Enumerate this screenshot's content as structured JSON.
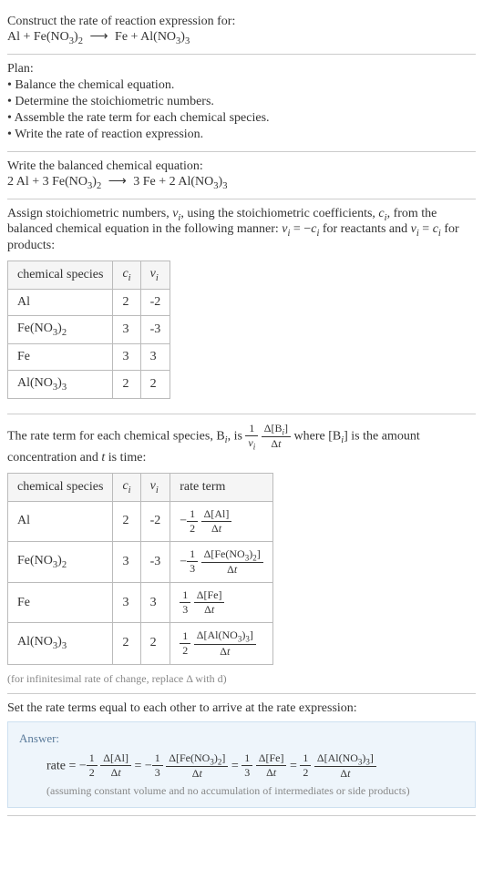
{
  "intro": {
    "prompt": "Construct the rate of reaction expression for:"
  },
  "plan": {
    "heading": "Plan:",
    "items": [
      "Balance the chemical equation.",
      "Determine the stoichiometric numbers.",
      "Assemble the rate term for each chemical species.",
      "Write the rate of reaction expression."
    ]
  },
  "balanced": {
    "heading": "Write the balanced chemical equation:"
  },
  "assign": {
    "text_before": "Assign stoichiometric numbers, ",
    "text_mid1": ", using the stoichiometric coefficients, ",
    "text_mid2": ", from the balanced chemical equation in the following manner: ",
    "text_mid3": " for reactants and ",
    "text_after": " for products:"
  },
  "table1": {
    "headers": [
      "chemical species",
      "cᵢ",
      "νᵢ"
    ],
    "rows": [
      {
        "species": "Al",
        "c": "2",
        "nu": "-2"
      },
      {
        "species": "Fe(NO₃)₂",
        "c": "3",
        "nu": "-3"
      },
      {
        "species": "Fe",
        "c": "3",
        "nu": "3"
      },
      {
        "species": "Al(NO₃)₃",
        "c": "2",
        "nu": "2"
      }
    ]
  },
  "rateterm": {
    "text1": "The rate term for each chemical species, B",
    "text2": ", is ",
    "text3": " where [B",
    "text4": "] is the amount concentration and ",
    "text5": " is time:"
  },
  "table2": {
    "headers": [
      "chemical species",
      "cᵢ",
      "νᵢ",
      "rate term"
    ],
    "rows": [
      {
        "species": "Al",
        "c": "2",
        "nu": "-2"
      },
      {
        "species": "Fe(NO₃)₂",
        "c": "3",
        "nu": "-3"
      },
      {
        "species": "Fe",
        "c": "3",
        "nu": "3"
      },
      {
        "species": "Al(NO₃)₃",
        "c": "2",
        "nu": "2"
      }
    ]
  },
  "note": "(for infinitesimal rate of change, replace Δ with d)",
  "setequal": "Set the rate terms equal to each other to arrive at the rate expression:",
  "answer": {
    "label": "Answer:",
    "prefix": "rate = ",
    "assumption": "(assuming constant volume and no accumulation of intermediates or side products)"
  },
  "chart_data": {
    "type": "table",
    "reaction_unbalanced": {
      "reactants": [
        {
          "coef": 1,
          "species": "Al"
        },
        {
          "coef": 1,
          "species": "Fe(NO3)2"
        }
      ],
      "products": [
        {
          "coef": 1,
          "species": "Fe"
        },
        {
          "coef": 1,
          "species": "Al(NO3)3"
        }
      ]
    },
    "reaction_balanced": {
      "reactants": [
        {
          "coef": 2,
          "species": "Al"
        },
        {
          "coef": 3,
          "species": "Fe(NO3)2"
        }
      ],
      "products": [
        {
          "coef": 3,
          "species": "Fe"
        },
        {
          "coef": 2,
          "species": "Al(NO3)3"
        }
      ]
    },
    "stoichiometric_table": [
      {
        "species": "Al",
        "c_i": 2,
        "nu_i": -2
      },
      {
        "species": "Fe(NO3)2",
        "c_i": 3,
        "nu_i": -3
      },
      {
        "species": "Fe",
        "c_i": 3,
        "nu_i": 3
      },
      {
        "species": "Al(NO3)3",
        "c_i": 2,
        "nu_i": 2
      }
    ],
    "rate_terms": [
      {
        "species": "Al",
        "c_i": 2,
        "nu_i": -2,
        "term": "-(1/2) Δ[Al]/Δt"
      },
      {
        "species": "Fe(NO3)2",
        "c_i": 3,
        "nu_i": -3,
        "term": "-(1/3) Δ[Fe(NO3)2]/Δt"
      },
      {
        "species": "Fe",
        "c_i": 3,
        "nu_i": 3,
        "term": "(1/3) Δ[Fe]/Δt"
      },
      {
        "species": "Al(NO3)3",
        "c_i": 2,
        "nu_i": 2,
        "term": "(1/2) Δ[Al(NO3)3]/Δt"
      }
    ],
    "rate_expression": "rate = -(1/2) Δ[Al]/Δt = -(1/3) Δ[Fe(NO3)2]/Δt = (1/3) Δ[Fe]/Δt = (1/2) Δ[Al(NO3)3]/Δt"
  }
}
